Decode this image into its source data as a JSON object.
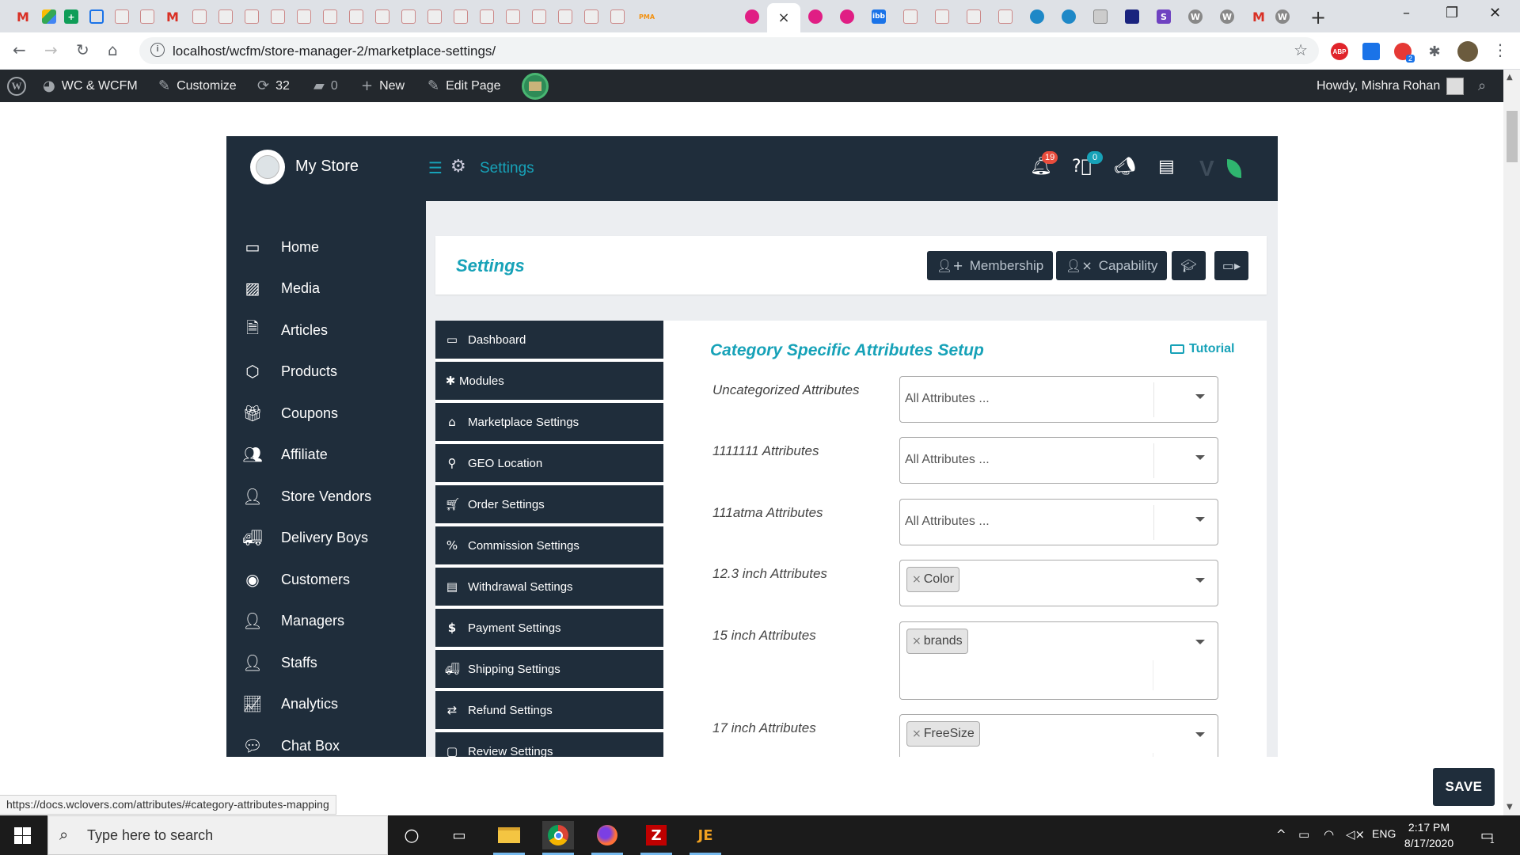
{
  "browser": {
    "active_tab_close": "×",
    "new_tab": "+",
    "url": "localhost/wcfm/store-manager-2/marketplace-settings/",
    "status_url": "https://docs.wclovers.com/attributes/#category-attributes-mapping",
    "extensions": [
      "ABP",
      "screenshot-icon",
      "2",
      "puzzle-icon",
      "profile-avatar"
    ],
    "ext_badge": "2"
  },
  "wp_admin_bar": {
    "site_name": "WC & WCFM",
    "customize": "Customize",
    "updates_count": "32",
    "comments_count": "0",
    "new_label": "New",
    "edit_page": "Edit Page",
    "howdy": "Howdy, Mishra Rohan"
  },
  "store_header": {
    "store_name": "My Store",
    "page_title": "Settings",
    "notifications_count": "19",
    "help_count": "0"
  },
  "sidebar": {
    "items": [
      {
        "label": "Home",
        "icon": "monitor-icon"
      },
      {
        "label": "Media",
        "icon": "image-icon"
      },
      {
        "label": "Articles",
        "icon": "file-icon"
      },
      {
        "label": "Products",
        "icon": "cube-icon"
      },
      {
        "label": "Coupons",
        "icon": "gift-icon"
      },
      {
        "label": "Affiliate",
        "icon": "users-icon"
      },
      {
        "label": "Store Vendors",
        "icon": "user-icon"
      },
      {
        "label": "Delivery Boys",
        "icon": "truck-icon"
      },
      {
        "label": "Customers",
        "icon": "user-circle-icon"
      },
      {
        "label": "Managers",
        "icon": "user-tie-icon"
      },
      {
        "label": "Staffs",
        "icon": "user-icon"
      },
      {
        "label": "Analytics",
        "icon": "chart-line-icon"
      },
      {
        "label": "Chat Box",
        "icon": "comments-icon"
      }
    ]
  },
  "settings_card": {
    "title": "Settings",
    "membership_btn": "Membership",
    "capability_btn": "Capability"
  },
  "subnav": {
    "items": [
      {
        "label": "Dashboard",
        "icon": "monitor-icon"
      },
      {
        "label": "Modules",
        "icon": "puzzle-icon"
      },
      {
        "label": "Marketplace Settings",
        "icon": "home-icon"
      },
      {
        "label": "GEO Location",
        "icon": "location-icon"
      },
      {
        "label": "Order Settings",
        "icon": "cart-icon"
      },
      {
        "label": "Commission Settings",
        "icon": "percent-icon"
      },
      {
        "label": "Withdrawal Settings",
        "icon": "card-icon"
      },
      {
        "label": "Payment Settings",
        "icon": "dollar-icon"
      },
      {
        "label": "Shipping Settings",
        "icon": "truck-icon"
      },
      {
        "label": "Refund Settings",
        "icon": "retweet-icon"
      },
      {
        "label": "Review Settings",
        "icon": "comment-icon"
      }
    ]
  },
  "attributes_section": {
    "title": "Category Specific Attributes Setup",
    "tutorial": "Tutorial",
    "placeholder": "All Attributes ...",
    "rows": [
      {
        "label": "Uncategorized Attributes",
        "chip": ""
      },
      {
        "label": "1111111 Attributes",
        "chip": ""
      },
      {
        "label": "111atma Attributes",
        "chip": ""
      },
      {
        "label": "12.3 inch Attributes",
        "chip": "Color"
      },
      {
        "label": "15 inch Attributes",
        "chip": "brands"
      },
      {
        "label": "17 inch Attributes",
        "chip": "FreeSize"
      }
    ]
  },
  "save_button": "SAVE",
  "taskbar": {
    "search_placeholder": "Type here to search",
    "language": "ENG",
    "time": "2:17 PM",
    "date": "8/17/2020",
    "notification_count": "1"
  },
  "colors": {
    "dark_navy": "#1f2d3b",
    "accent_teal": "#17a2b8",
    "wp_bar": "#23282d",
    "badge_red": "#e74c3c"
  }
}
